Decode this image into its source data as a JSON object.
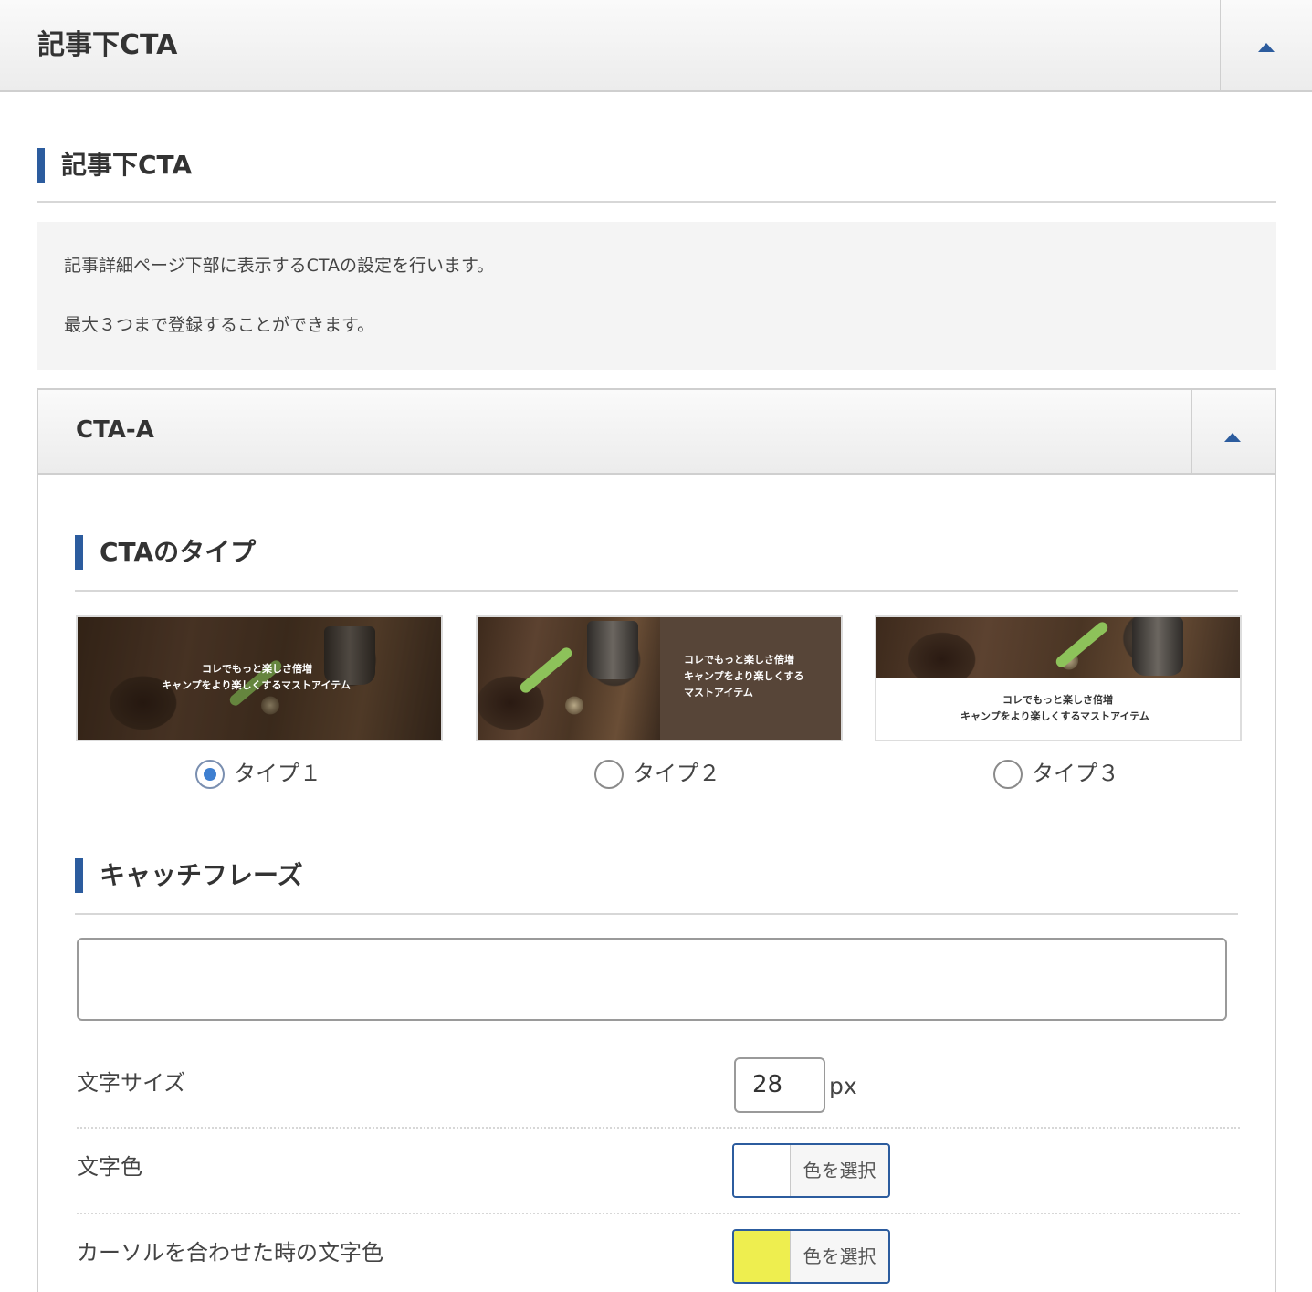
{
  "header": {
    "title": "記事下CTA"
  },
  "section": {
    "title": "記事下CTA"
  },
  "notice": {
    "line1": "記事詳細ページ下部に表示するCTAの設定を行います。",
    "line2": "最大３つまで登録することができます。"
  },
  "cta_panel": {
    "title": "CTA-A",
    "type_section": {
      "title": "CTAのタイプ",
      "options": [
        {
          "label": "タイプ１",
          "checked": true,
          "preview_text": [
            "コレでもっと楽しさ倍増",
            "キャンプをより楽しくするマストアイテム"
          ]
        },
        {
          "label": "タイプ２",
          "checked": false,
          "preview_text": [
            "コレでもっと楽しさ倍増",
            "キャンプをより楽しくする",
            "マストアイテム"
          ]
        },
        {
          "label": "タイプ３",
          "checked": false,
          "preview_text": [
            "コレでもっと楽しさ倍増",
            "キャンプをより楽しくするマストアイテム"
          ]
        }
      ]
    },
    "catchphrase_section": {
      "title": "キャッチフレーズ",
      "input_value": "",
      "font_size": {
        "label": "文字サイズ",
        "value": "28",
        "unit": "px"
      },
      "text_color": {
        "label": "文字色",
        "swatch": "#ffffff",
        "button_label": "色を選択"
      },
      "hover_color": {
        "label": "カーソルを合わせた時の文字色",
        "swatch": "#eeee4f",
        "button_label": "色を選択"
      }
    }
  },
  "colors": {
    "accent": "#2c5c9e",
    "radio_checked": "#3e7fd0",
    "type2_panel": "#574538"
  }
}
